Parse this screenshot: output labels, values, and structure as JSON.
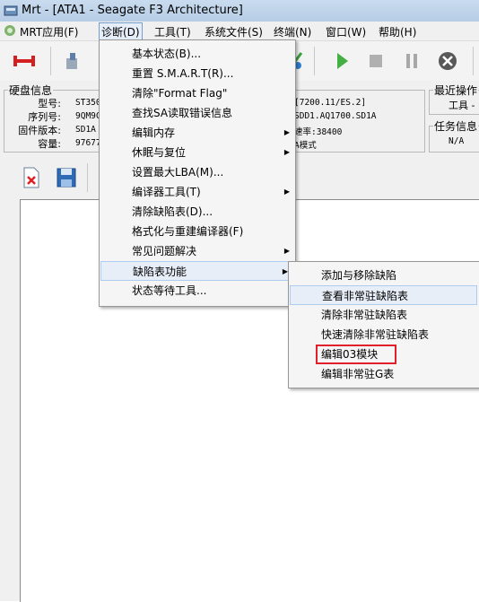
{
  "window": {
    "title": "Mrt - [ATA1 - Seagate F3 Architecture]"
  },
  "menubar": {
    "items": [
      "MRT应用(F)",
      "诊断(D)",
      "工具(T)",
      "系统文件(S)",
      "终端(N)",
      "窗口(W)",
      "帮助(H)"
    ]
  },
  "info": {
    "legend": "硬盘信息",
    "labels": [
      "型号:",
      "序列号:",
      "固件版本:",
      "容量:"
    ],
    "values": [
      "ST350",
      "9QM9C",
      "SD1A",
      "97677"
    ],
    "right_values": [
      "[7200.11/ES.2]",
      "SDD1.AQ1700.SD1A",
      "速率:38400",
      "A模式"
    ],
    "recent_legend": "最近操作",
    "recent_value": "工具 -",
    "task_legend": "任务信息",
    "task_value": "N/A"
  },
  "diag_menu": [
    {
      "label": "基本状态(B)...",
      "arrow": false
    },
    {
      "label": "重置 S.M.A.R.T(R)...",
      "arrow": false
    },
    {
      "label": "清除\"Format Flag\"",
      "arrow": false
    },
    {
      "label": "查找SA读取错误信息",
      "arrow": false
    },
    {
      "label": "编辑内存",
      "arrow": true
    },
    {
      "label": "休眠与复位",
      "arrow": true
    },
    {
      "label": "设置最大LBA(M)...",
      "arrow": false
    },
    {
      "label": "编译器工具(T)",
      "arrow": true
    },
    {
      "label": "清除缺陷表(D)...",
      "arrow": false
    },
    {
      "label": "格式化与重建编译器(F)",
      "arrow": false
    },
    {
      "label": "常见问题解决",
      "arrow": true
    },
    {
      "label": "缺陷表功能",
      "arrow": true
    },
    {
      "label": "状态等待工具...",
      "arrow": false
    }
  ],
  "defect_submenu": [
    {
      "label": "添加与移除缺陷"
    },
    {
      "label": "查看非常驻缺陷表"
    },
    {
      "label": "清除非常驻缺陷表"
    },
    {
      "label": "快速清除非常驻缺陷表"
    },
    {
      "label": "编辑03模块"
    },
    {
      "label": "编辑非常驻G表"
    }
  ],
  "colors": {
    "highlight": "#e8eef8",
    "marker": "#e0202a"
  }
}
